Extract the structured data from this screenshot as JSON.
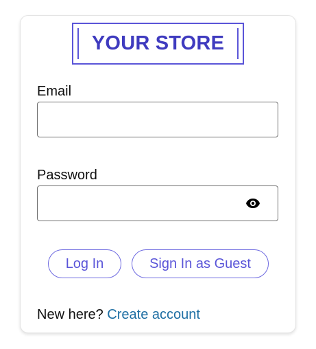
{
  "logo": {
    "text": "YOUR STORE"
  },
  "form": {
    "email_label": "Email",
    "email_value": "",
    "password_label": "Password",
    "password_value": ""
  },
  "actions": {
    "login_label": "Log In",
    "guest_label": "Sign In as Guest"
  },
  "footer": {
    "prompt": "New here?",
    "link": "Create account"
  },
  "icons": {
    "password_toggle": "eye-icon"
  },
  "colors": {
    "accent": "#5a55d8",
    "logo_text": "#3f3bbf",
    "link": "#1d6ea3"
  }
}
